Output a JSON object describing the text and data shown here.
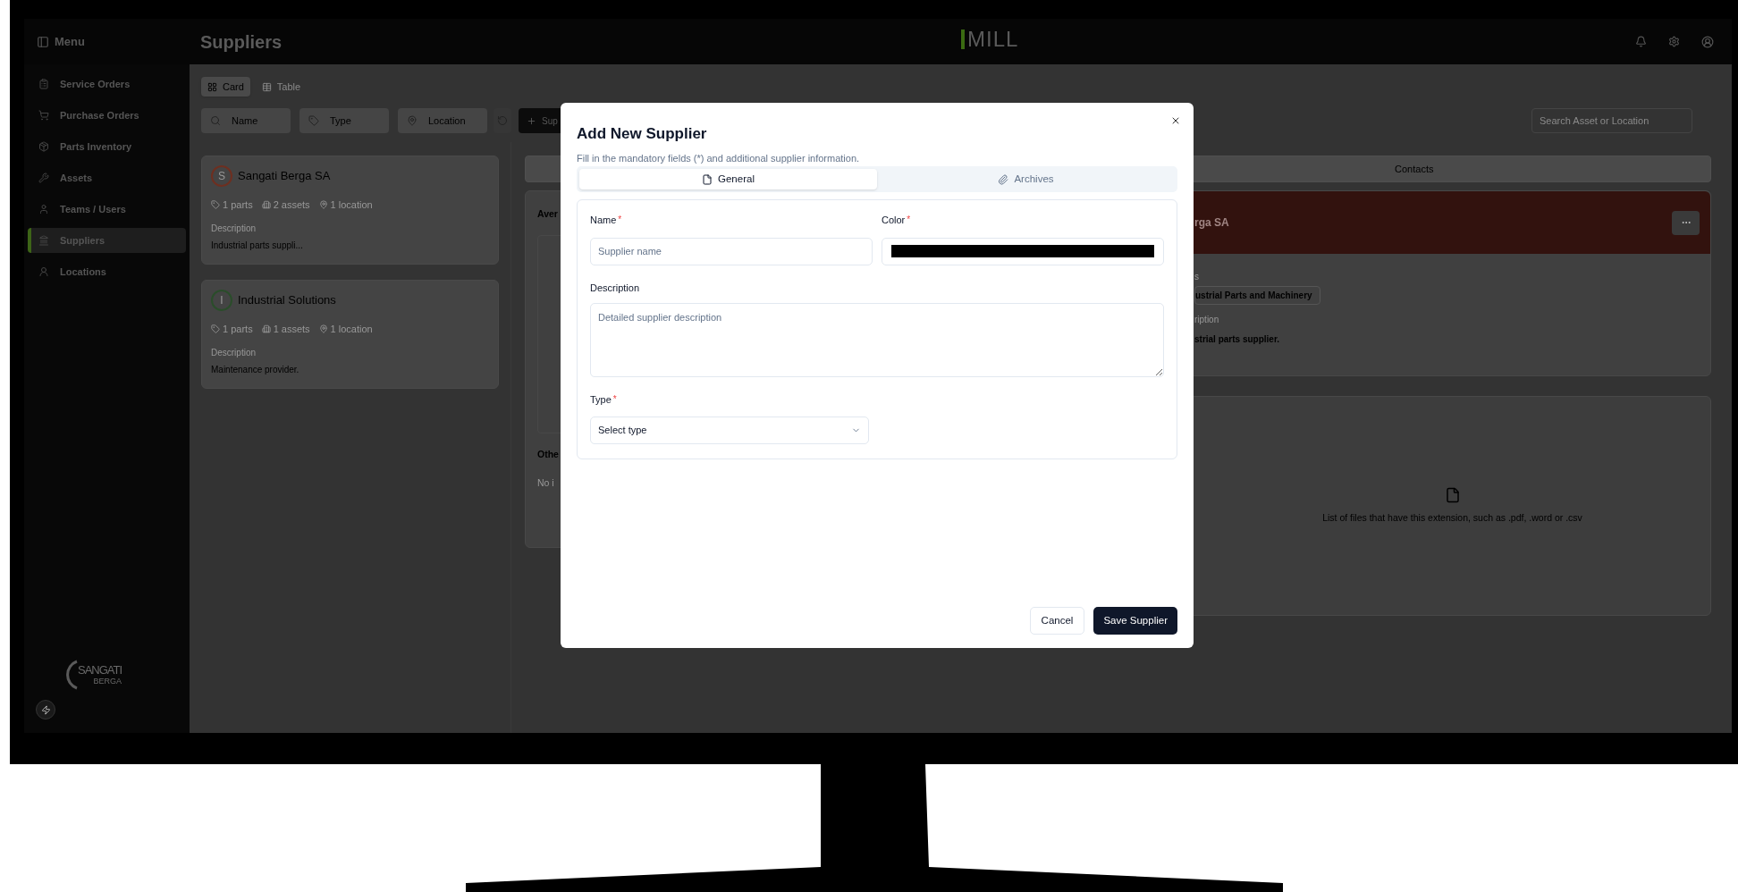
{
  "top_bar": {
    "menu_label": "Menu",
    "page_title": "Suppliers",
    "logo": "MILL"
  },
  "sidebar": {
    "items": [
      {
        "kind": "clipboard",
        "label": "Service Orders",
        "selected": false
      },
      {
        "kind": "cart",
        "label": "Purchase Orders",
        "selected": false
      },
      {
        "kind": "package",
        "label": "Parts Inventory",
        "selected": false
      },
      {
        "kind": "wrench",
        "label": "Assets",
        "selected": false
      },
      {
        "kind": "user",
        "label": "Teams / Users",
        "selected": false
      },
      {
        "kind": "bank",
        "label": "Suppliers",
        "selected": true
      },
      {
        "kind": "person",
        "label": "Locations",
        "selected": false
      }
    ],
    "brand": "SANGATI",
    "brand_sub": "BERGA"
  },
  "view_toggle": [
    {
      "kind": "grid",
      "label": "Card",
      "selected": true
    },
    {
      "kind": "table",
      "label": "Table",
      "selected": false
    }
  ],
  "filters": [
    {
      "kind": "search",
      "label": "Name"
    },
    {
      "kind": "tag",
      "label": "Type"
    },
    {
      "kind": "pin",
      "label": "Location"
    }
  ],
  "add_button": "Sup",
  "search": {
    "placeholder": "Search Asset or Location"
  },
  "suppliers": [
    {
      "initial": "S",
      "name": "Sangati Berga SA",
      "color": "#6e2f20",
      "parts": "1 parts",
      "assets": "2 assets",
      "locations": "1 location",
      "description_label": "Description",
      "description": "Industrial parts suppli..."
    },
    {
      "initial": "I",
      "name": "Industrial Solutions",
      "color": "#2a4d2a",
      "parts": "1 parts",
      "assets": "1 assets",
      "locations": "1 location",
      "description_label": "Description",
      "description": "Maintenance provider."
    }
  ],
  "details": {
    "tab": "Contacts",
    "heading": "Aver",
    "other_heading": "Othe",
    "other_text": "No i",
    "header_name": "rga SA",
    "types_label": "s",
    "types_chip": "ustrial Parts and Machinery",
    "description_label": "ription",
    "description": "strial parts supplier.",
    "files_empty": "List of files that have this extension, such as .pdf, .word or .csv"
  },
  "dialog": {
    "title": "Add New Supplier",
    "subtitle": "Fill in the mandatory fields (*) and additional supplier information.",
    "tabs": [
      {
        "kind": "file",
        "label": "General",
        "selected": true
      },
      {
        "kind": "clip",
        "label": "Archives",
        "selected": false
      }
    ],
    "name": {
      "label": "Name",
      "required_mark": "*",
      "placeholder": "Supplier name"
    },
    "color": {
      "label": "Color",
      "required_mark": "*",
      "color": "#000000"
    },
    "description": {
      "label": "Description",
      "placeholder": "Detailed supplier description"
    },
    "type": {
      "label": "Type",
      "required_mark": "*",
      "placeholder": "Select type"
    },
    "cancel": "Cancel",
    "save": "Save Supplier"
  }
}
